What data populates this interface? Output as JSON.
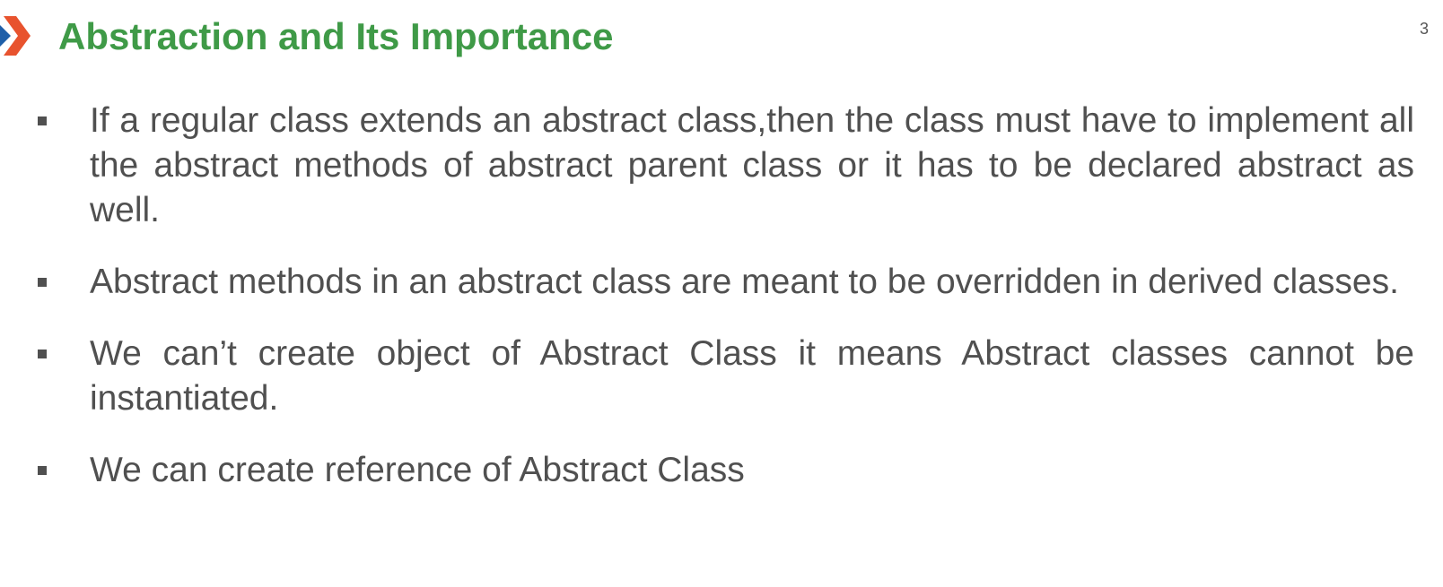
{
  "slide": {
    "title": "Abstraction and Its Importance",
    "page_number": "3",
    "colors": {
      "title": "#3f9a47",
      "body_text": "#505050",
      "logo_blue": "#1f5fa8",
      "logo_orange": "#e8532e"
    },
    "bullets": [
      "If a regular class extends an abstract class,then the class must have to implement all the abstract methods of abstract parent class or it has to be declared abstract as well.",
      "Abstract methods in an abstract class are meant to be overridden in derived classes.",
      "We can’t create object of Abstract Class it means Abstract classes cannot be instantiated.",
      "We can create reference of Abstract Class"
    ]
  }
}
